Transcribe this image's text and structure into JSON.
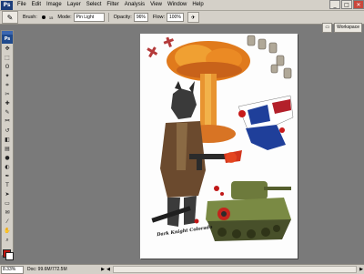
{
  "app": {
    "logo": "Ps"
  },
  "menu": {
    "items": [
      "File",
      "Edit",
      "Image",
      "Layer",
      "Select",
      "Filter",
      "Analysis",
      "View",
      "Window",
      "Help"
    ]
  },
  "window_controls": {
    "minimize": "_",
    "maximize": "□",
    "close": "✕"
  },
  "options_bar": {
    "brush_label": "Brush:",
    "brush_size": "15",
    "mode_label": "Mode:",
    "mode_value": "Pin Light",
    "opacity_label": "Opacity:",
    "opacity_value": "96%",
    "flow_label": "Flow:",
    "flow_value": "100%",
    "workspace_label": "Workspace"
  },
  "tools": [
    "move-icon",
    "marquee-icon",
    "lasso-icon",
    "magic-wand-icon",
    "crop-icon",
    "slice-icon",
    "healing-icon",
    "brush-icon",
    "clone-stamp-icon",
    "history-brush-icon",
    "eraser-icon",
    "gradient-icon",
    "blur-icon",
    "dodge-icon",
    "pen-icon",
    "type-icon",
    "path-select-icon",
    "shape-icon",
    "notes-icon",
    "eyedropper-icon",
    "hand-icon",
    "zoom-icon"
  ],
  "tool_glyphs": [
    "✥",
    "⬚",
    "ʘ",
    "✦",
    "⌗",
    "✂",
    "✚",
    "✎",
    "⎃",
    "↺",
    "◧",
    "▤",
    "●",
    "◐",
    "✒",
    "T",
    "➤",
    "▭",
    "✉",
    "⁄",
    "✋",
    "⌕"
  ],
  "colors": {
    "foreground": "#c0140f",
    "background": "#ffffff"
  },
  "artwork": {
    "caption": "Dark Knight Colorado"
  },
  "status_bar": {
    "zoom": "8.33%",
    "doc_info": "Doc: 99.6M/772.5M"
  }
}
